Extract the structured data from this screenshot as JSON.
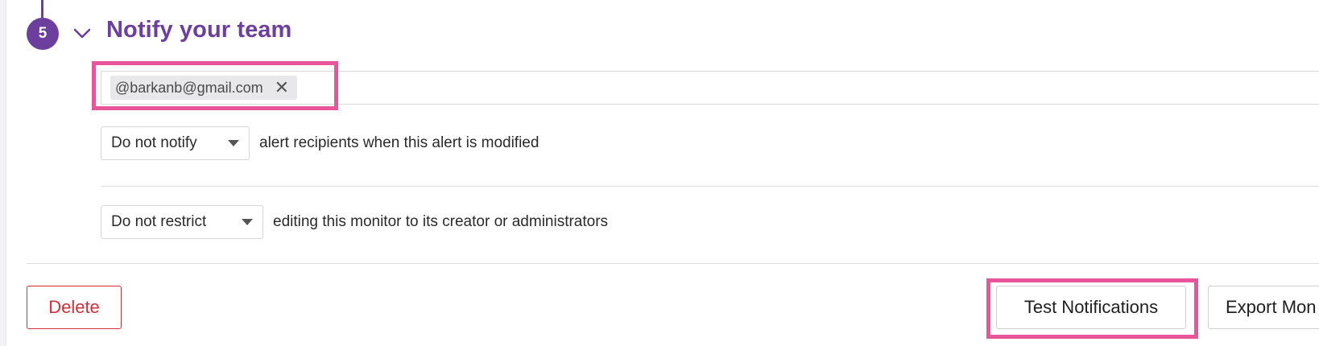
{
  "step": {
    "number": "5",
    "title": "Notify your team"
  },
  "recipients": {
    "tags": [
      {
        "label": "@barkanb@gmail.com"
      }
    ]
  },
  "notify_modified": {
    "select_value": "Do not notify",
    "description": "alert recipients when this alert is modified"
  },
  "restrict_editing": {
    "select_value": "Do not restrict",
    "description": "editing this monitor to its creator or administrators"
  },
  "actions": {
    "delete_label": "Delete",
    "test_label": "Test Notifications",
    "export_label": "Export Mon"
  },
  "colors": {
    "accent": "#6c3f9e",
    "danger": "#d32f3a",
    "highlight": "#e8559a"
  },
  "icons": {
    "chevron": "chevron-down-icon",
    "tag_remove": "close-icon",
    "select_caret": "caret-down-icon"
  }
}
